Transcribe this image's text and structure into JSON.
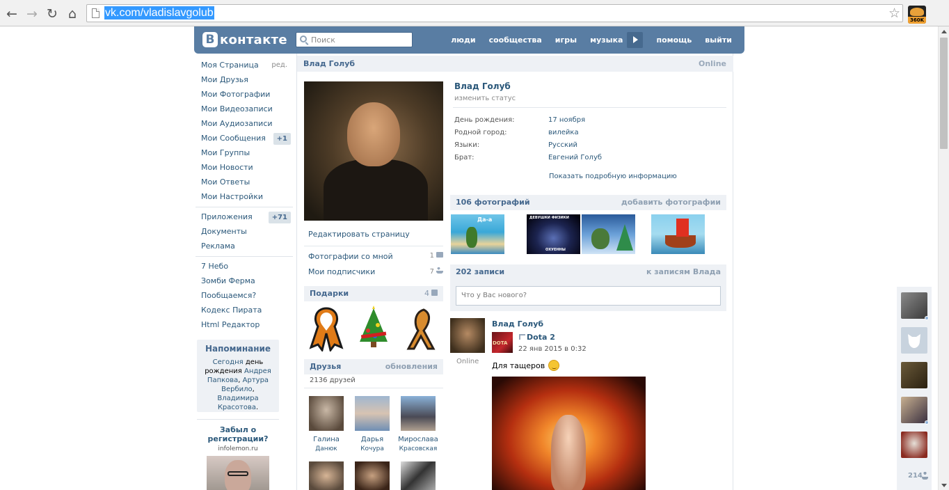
{
  "browser": {
    "url": "vk.com/vladislavgolub",
    "extension_badge": "360K"
  },
  "header": {
    "logo_letter": "B",
    "logo_text": "контакте",
    "search_placeholder": "Поиск",
    "nav": [
      "люди",
      "сообщества",
      "игры",
      "музыка",
      "помощь",
      "выйти"
    ],
    "brand_color": "#597da3"
  },
  "left_menu": {
    "items": [
      {
        "label": "Моя Страница",
        "side": "ред."
      },
      {
        "label": "Мои Друзья"
      },
      {
        "label": "Мои Фотографии"
      },
      {
        "label": "Мои Видеозаписи"
      },
      {
        "label": "Мои Аудиозаписи"
      },
      {
        "label": "Мои Сообщения",
        "count": "+1"
      },
      {
        "label": "Мои Группы"
      },
      {
        "label": "Мои Новости"
      },
      {
        "label": "Мои Ответы"
      },
      {
        "label": "Мои Настройки"
      }
    ],
    "apps": [
      {
        "label": "Приложения",
        "count": "+71"
      },
      {
        "label": "Документы"
      },
      {
        "label": "Реклама"
      }
    ],
    "games": [
      {
        "label": "7 Небо"
      },
      {
        "label": "Зомби Ферма"
      },
      {
        "label": "Пообщаемся?"
      },
      {
        "label": "Кодекс Пирата"
      },
      {
        "label": "Html Редактор"
      }
    ]
  },
  "reminder": {
    "title": "Напоминание",
    "today": "Сегодня",
    "text_a": " день рождения ",
    "name1": "Андрея Папкова",
    "sep1": ", ",
    "name2": "Артура Вербило",
    "sep2": ", ",
    "name3": "Владимира Красотова",
    "end": "."
  },
  "ad": {
    "title": "Забыл о регистрации?",
    "domain": "infolemon.ru"
  },
  "profile": {
    "header_name": "Влад Голуб",
    "online": "Online",
    "name": "Влад Голуб",
    "status": "изменить статус",
    "info": [
      {
        "label": "День рождения:",
        "value": "17 ноября"
      },
      {
        "label": "Родной город:",
        "value": "вилейка"
      },
      {
        "label": "Языки:",
        "value": "Русский"
      },
      {
        "label": "Брат:",
        "value": "Евгений Голуб"
      }
    ],
    "show_more": "Показать подробную информацию",
    "edit_page": "Редактировать страницу",
    "photos_with_me": "Фотографии со мной",
    "photos_with_me_count": "1",
    "subscribers": "Мои подписчики",
    "subscribers_count": "7"
  },
  "gifts": {
    "title": "Подарки",
    "count": "4"
  },
  "friends": {
    "title": "Друзья",
    "action": "обновления",
    "total": "2136 друзей",
    "list": [
      {
        "first": "Галина",
        "last": "Данюк"
      },
      {
        "first": "Дарья",
        "last": "Кочура"
      },
      {
        "first": "Мирослава",
        "last": "Красовская"
      }
    ]
  },
  "photos": {
    "title": "106 фотографий",
    "action": "добавить фотографии",
    "captions": [
      "Да-а",
      "ДЕВУШКИ ФИЗИКИ",
      "ОХУЕННЫ"
    ]
  },
  "wall": {
    "title": "202 записи",
    "action": "к записям Влада",
    "input_placeholder": "Что у Вас нового?",
    "post": {
      "author": "Влад Голуб",
      "author_status": "Online",
      "repost_from": "Dota 2",
      "repost_thumb_text": "DOTA",
      "date": "22 янв 2015 в 0:32",
      "text": "Для тащеров"
    }
  },
  "dock": {
    "count": "214"
  }
}
